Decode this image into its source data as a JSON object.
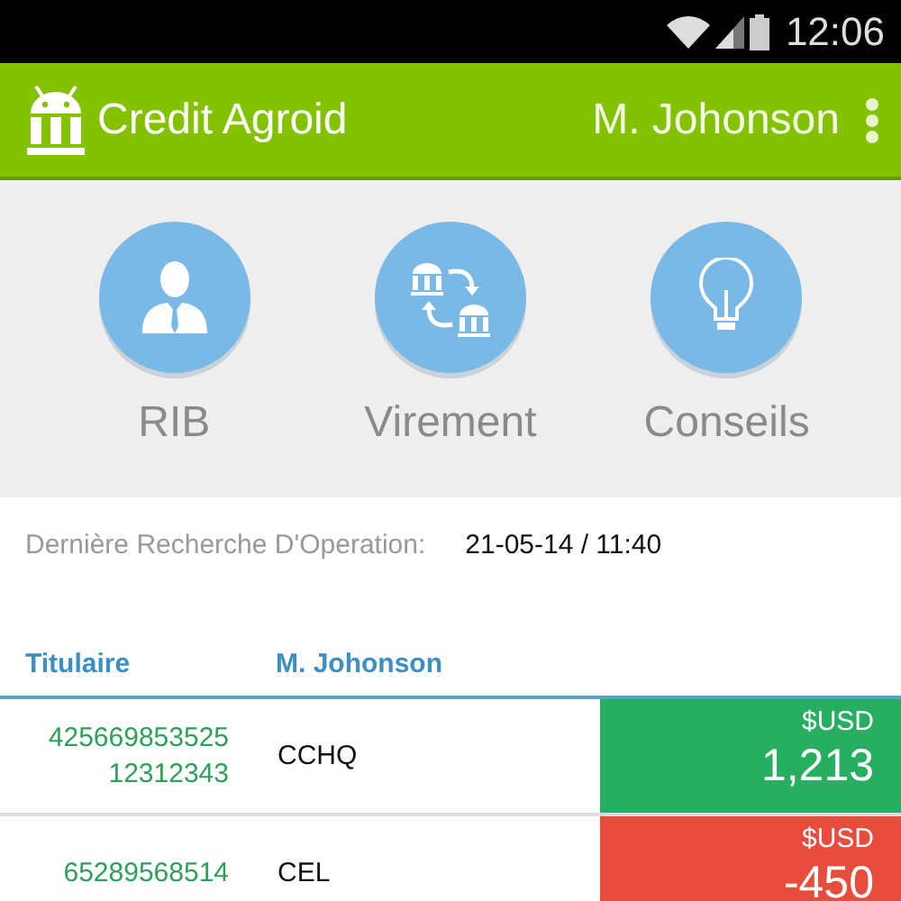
{
  "status_bar": {
    "time": "12:06"
  },
  "app_bar": {
    "title": "Credit Agroid",
    "user": "M. Johonson"
  },
  "actions": [
    {
      "kind": "person",
      "label": "RIB"
    },
    {
      "kind": "transfer",
      "label": "Virement"
    },
    {
      "kind": "bulb",
      "label": "Conseils"
    }
  ],
  "last_search": {
    "label": "Dernière Recherche D'Operation:",
    "value": "21-05-14 / 11:40"
  },
  "table": {
    "columns": [
      "Titulaire",
      "M. Johonson"
    ],
    "rows": [
      {
        "account_lines": [
          "425669853525",
          "12312343"
        ],
        "code": "CCHQ",
        "currency": "$USD",
        "amount": "1,213",
        "color": "#27ae60"
      },
      {
        "account_lines": [
          "65289568514"
        ],
        "code": "CEL",
        "currency": "$USD",
        "amount": "-450",
        "color": "#e74c3c"
      }
    ]
  }
}
